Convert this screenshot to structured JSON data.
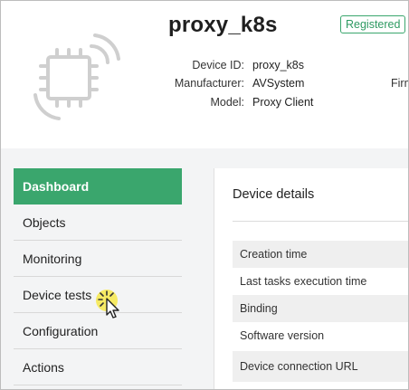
{
  "device": {
    "title": "proxy_k8s",
    "status_badge": "Registered",
    "icon": "chip-wireless-icon",
    "fields": [
      {
        "label": "Device ID:",
        "value": "proxy_k8s"
      },
      {
        "label": "Manufacturer:",
        "value": "AVSystem"
      },
      {
        "label": "Model:",
        "value": "Proxy Client"
      }
    ],
    "cut_label": "Firm"
  },
  "sidebar": {
    "items": [
      {
        "label": "Dashboard",
        "active": true
      },
      {
        "label": "Objects"
      },
      {
        "label": "Monitoring"
      },
      {
        "label": "Device tests"
      },
      {
        "label": "Configuration"
      },
      {
        "label": "Actions"
      }
    ]
  },
  "panel": {
    "title": "Device details",
    "rows": [
      "Creation time",
      "Last tasks execution time",
      "Binding",
      "Software version",
      "Device connection URL"
    ]
  },
  "colors": {
    "accent": "#3aa66d",
    "badge": "#2e9a62",
    "icon": "#cfcfcf",
    "cursor_highlight": "#f6e84a"
  },
  "cursor": {
    "icon": "pointer-cursor-icon"
  }
}
